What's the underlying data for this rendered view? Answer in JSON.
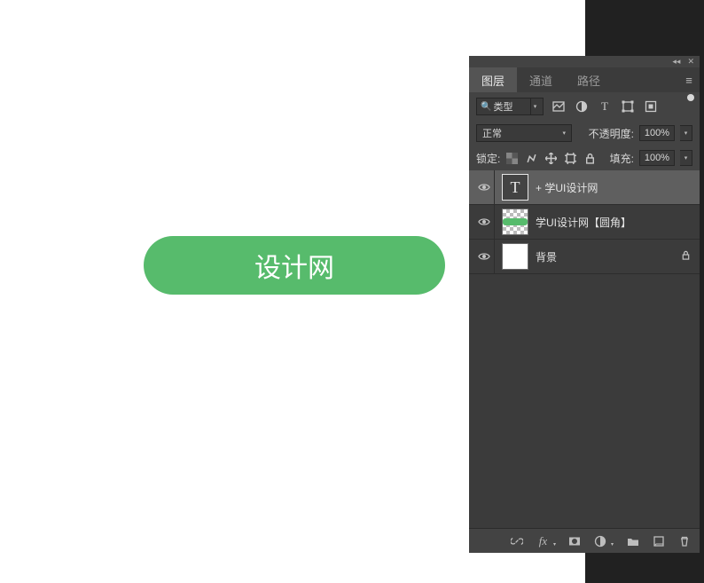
{
  "canvas": {
    "button_text": "设计网"
  },
  "panel": {
    "tabs": {
      "layers": "图层",
      "channels": "通道",
      "paths": "路径"
    },
    "filter": {
      "type_label": "类型"
    },
    "blend_row": {
      "mode": "正常",
      "opacity_label": "不透明度:",
      "opacity_value": "100%"
    },
    "lock_row": {
      "label": "锁定:",
      "fill_label": "填充:",
      "fill_value": "100%"
    },
    "layers": [
      {
        "name": "+ 学UI设计网",
        "type": "text",
        "selected": true
      },
      {
        "name": "学UI设计网【圆角】",
        "type": "shape",
        "selected": false
      },
      {
        "name": "背景",
        "type": "bg",
        "selected": false,
        "locked": true
      }
    ]
  }
}
